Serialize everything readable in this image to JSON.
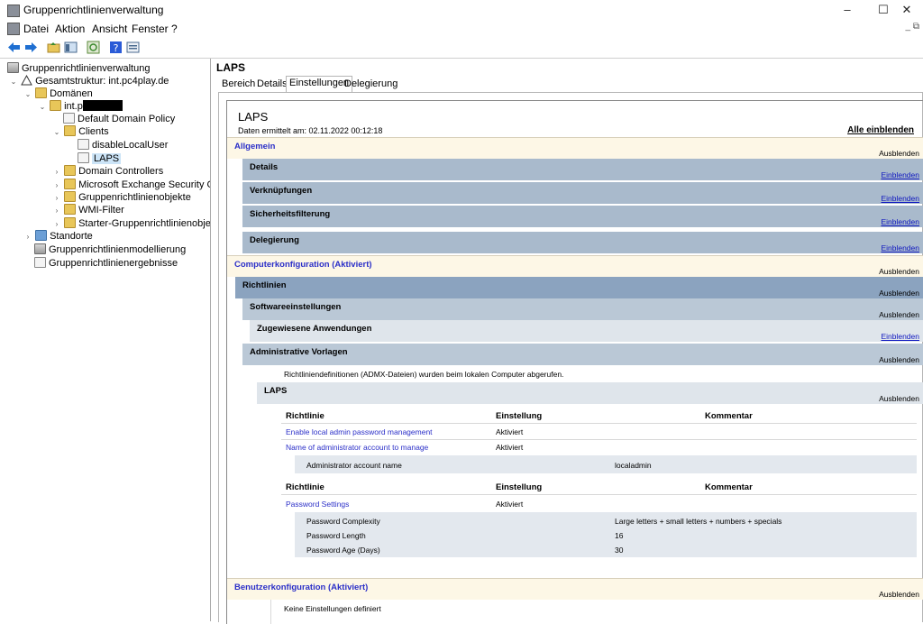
{
  "window": {
    "title": "Gruppenrichtlinienverwaltung",
    "min": "–",
    "max": "☐",
    "close": "✕"
  },
  "menu": [
    "Datei",
    "Aktion",
    "Ansicht",
    "Fenster",
    "?"
  ],
  "mdi": "_ ⧉",
  "tree": {
    "root": "Gruppenrichtlinienverwaltung",
    "forest": "Gesamtstruktur: int.pc4play.de",
    "domains": "Domänen",
    "domain": "int.p",
    "ddp": "Default Domain Policy",
    "clients": "Clients",
    "disable": "disableLocalUser",
    "laps": "LAPS",
    "dc": "Domain Controllers",
    "exch": "Microsoft Exchange Security Groups",
    "gpo": "Gruppenrichtlinienobjekte",
    "wmi": "WMI-Filter",
    "starter": "Starter-Gruppenrichtlinienobjekte",
    "sites": "Standorte",
    "model": "Gruppenrichtlinienmodellierung",
    "results": "Gruppenrichtlinienergebnisse"
  },
  "right": {
    "title": "LAPS",
    "tabs": [
      "Bereich",
      "Details",
      "Einstellungen",
      "Delegierung"
    ]
  },
  "report": {
    "header": "LAPS",
    "generated": "Daten ermittelt am: 02.11.2022 00:12:18",
    "show_all": "Alle einblenden",
    "general": "Allgemein",
    "hide": "Ausblenden",
    "show": "Einblenden",
    "details": "Details",
    "links": "Verknüpfungen",
    "security": "Sicherheitsfilterung",
    "delegation": "Delegierung",
    "computer": "Computerkonfiguration (Aktiviert)",
    "policies": "Richtlinien",
    "software": "Softwareeinstellungen",
    "assigned": "Zugewiesene Anwendungen",
    "admin_templates": "Administrative Vorlagen",
    "admx_note": "Richtliniendefinitionen (ADMX-Dateien) wurden beim lokalen Computer abgerufen.",
    "laps_section": "LAPS",
    "col_policy": "Richtlinie",
    "col_setting": "Einstellung",
    "col_comment": "Kommentar",
    "rows1": [
      {
        "policy": "Enable local admin password management",
        "setting": "Aktiviert"
      },
      {
        "policy": "Name of administrator account to manage",
        "setting": "Aktiviert"
      }
    ],
    "sub1": [
      {
        "name": "Administrator account name",
        "value": "localadmin"
      }
    ],
    "rows2": [
      {
        "policy": "Password Settings",
        "setting": "Aktiviert"
      }
    ],
    "sub2": [
      {
        "name": "Password Complexity",
        "value": "Large letters + small letters + numbers + specials"
      },
      {
        "name": "Password Length",
        "value": "16"
      },
      {
        "name": "Password Age (Days)",
        "value": "30"
      }
    ],
    "user": "Benutzerkonfiguration (Aktiviert)",
    "no_settings": "Keine Einstellungen definiert"
  }
}
